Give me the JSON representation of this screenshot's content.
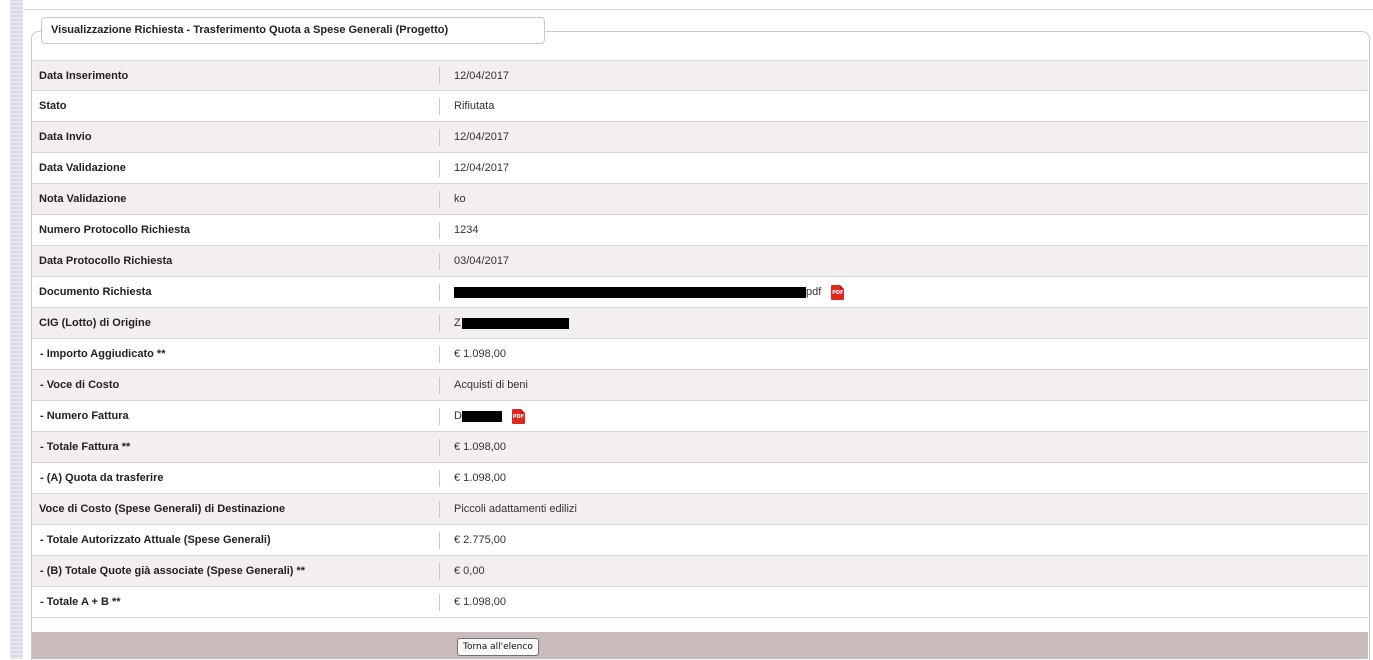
{
  "panel": {
    "title": "Visualizzazione Richiesta - Trasferimento Quota a Spese Generali (Progetto)"
  },
  "rows": [
    {
      "label": "Data Inserimento",
      "value": "12/04/2017"
    },
    {
      "label": "Stato",
      "value": "Rifiutata"
    },
    {
      "label": "Data Invio",
      "value": "12/04/2017"
    },
    {
      "label": "Data Validazione",
      "value": "12/04/2017"
    },
    {
      "label": "Nota Validazione",
      "value": "ko"
    },
    {
      "label": "Numero Protocollo Richiesta",
      "value": "1234"
    },
    {
      "label": "Data Protocollo Richiesta",
      "value": "03/04/2017"
    },
    {
      "label": "Documento Richiesta",
      "value_suffix": "pdf",
      "icon": "pdf-file-icon"
    },
    {
      "label": "CIG (Lotto) di Origine",
      "value_prefix": "Z"
    },
    {
      "label": "- Importo Aggiudicato **",
      "value": "€ 1.098,00"
    },
    {
      "label": "- Voce di Costo",
      "value": "Acquisti di beni"
    },
    {
      "label": "- Numero Fattura",
      "value_prefix": "D",
      "icon": "pdf-file-icon"
    },
    {
      "label": "- Totale Fattura **",
      "value": "€ 1.098,00"
    },
    {
      "label": "- (A) Quota da trasferire",
      "value": "€ 1.098,00"
    },
    {
      "label": "Voce di Costo (Spese Generali) di Destinazione",
      "value": "Piccoli adattamenti edilizi"
    },
    {
      "label": "- Totale Autorizzato Attuale (Spese Generali)",
      "value": "€ 2.775,00"
    },
    {
      "label": "- (B) Totale Quote già associate (Spese Generali) **",
      "value": "€ 0,00"
    },
    {
      "label": "- Totale A + B **",
      "value": "€ 1.098,00"
    }
  ],
  "pdf_icon_text": "PDF",
  "footer": {
    "back_label": "Torna all'elenco"
  },
  "colors": {
    "row_alt": "#f3eeef",
    "footer_bar": "#cbbcbc",
    "pdf_red": "#e0261f"
  }
}
